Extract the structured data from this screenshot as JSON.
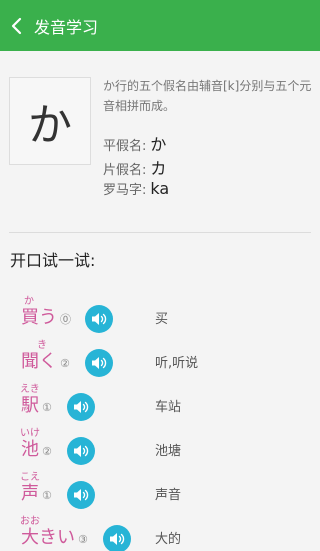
{
  "header": {
    "title": "发音学习"
  },
  "kana": {
    "display": "か",
    "description": "か行的五个假名由辅音[k]分别与五个元音相拼而成。",
    "hiragana_label": "平假名:",
    "hiragana_value": "か",
    "katakana_label": "片假名:",
    "katakana_value": "カ",
    "romaji_label": "罗马字:",
    "romaji_value": "ka"
  },
  "practice": {
    "title": "开口试一试:",
    "items": [
      {
        "furigana": "か",
        "word": "買う",
        "tone": "⓪",
        "meaning": "买"
      },
      {
        "furigana": "き",
        "word": "聞く",
        "tone": "②",
        "meaning": "听,听说"
      },
      {
        "furigana": "えき",
        "word": "駅",
        "tone": "①",
        "meaning": "车站"
      },
      {
        "furigana": "いけ",
        "word": "池",
        "tone": "②",
        "meaning": "池塘"
      },
      {
        "furigana": "こえ",
        "word": "声",
        "tone": "①",
        "meaning": "声音"
      },
      {
        "furigana": "おお",
        "word": "大きい",
        "tone": "③",
        "meaning": "大的"
      }
    ]
  },
  "colors": {
    "appbar": "#3ab04c",
    "word": "#cf5a9b",
    "speaker": "#27b4d6"
  },
  "icons": {
    "back": "chevron-left-icon",
    "speaker": "speaker-icon"
  }
}
